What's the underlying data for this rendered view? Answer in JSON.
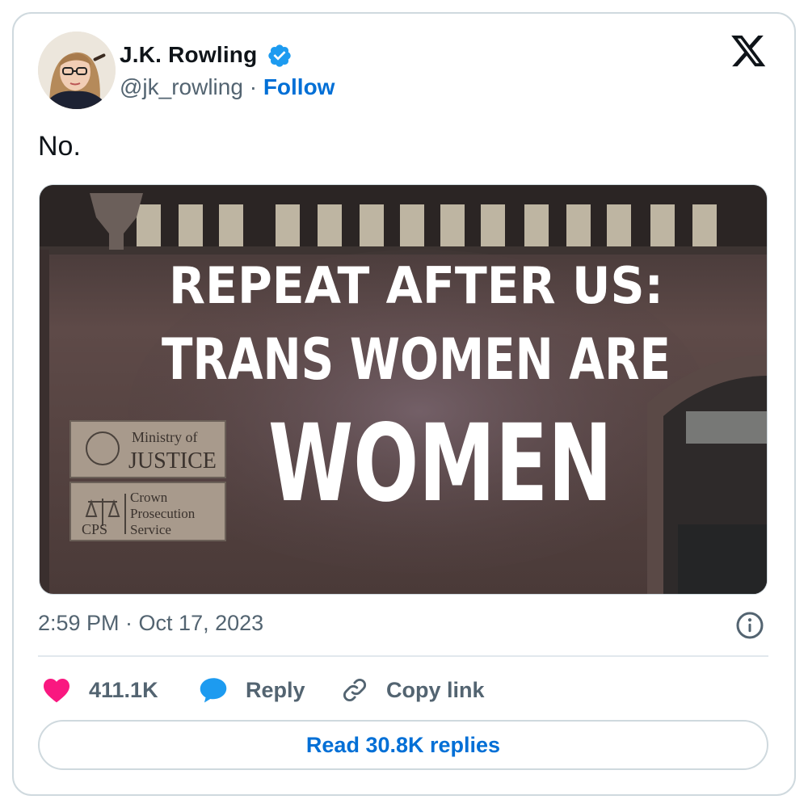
{
  "author": {
    "name": "J.K. Rowling",
    "handle": "@jk_rowling",
    "separator": "·",
    "follow_label": "Follow",
    "verified": true
  },
  "tweet": {
    "text": "No.",
    "timestamp": "2:59 PM · Oct 17, 2023"
  },
  "media": {
    "projection_line1": "REPEAT AFTER US:",
    "projection_line2": "TRANS WOMEN ARE",
    "projection_line3": "WOMEN",
    "sign1_line1": "Ministry of",
    "sign1_line2": "JUSTICE",
    "sign2_abbrev": "CPS",
    "sign2_line1": "Crown",
    "sign2_line2": "Prosecution",
    "sign2_line3": "Service"
  },
  "actions": {
    "likes": "411.1K",
    "reply_label": "Reply",
    "copy_label": "Copy link"
  },
  "read_replies_label": "Read 30.8K replies",
  "icons": {
    "like": "heart-icon",
    "reply": "speech-bubble-icon",
    "copy": "link-icon",
    "info": "info-icon",
    "brand": "x-logo-icon",
    "verified": "verified-badge-icon"
  },
  "colors": {
    "accent": "#006fd6",
    "verified": "#1d9bf0",
    "like": "#f91880",
    "muted": "#536471",
    "border": "#cfd9de"
  }
}
